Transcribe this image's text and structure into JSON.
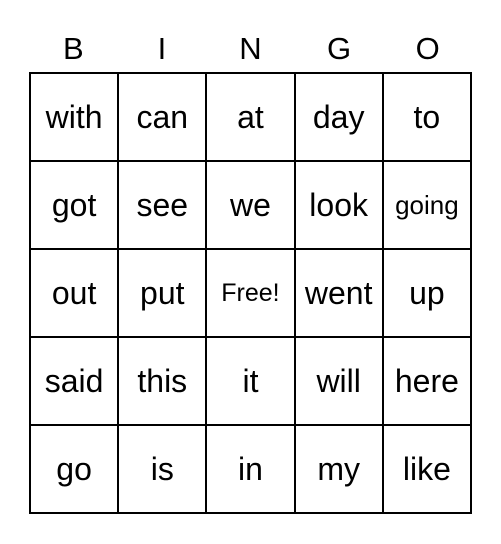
{
  "header": [
    "B",
    "I",
    "N",
    "G",
    "O"
  ],
  "rows": [
    [
      "with",
      "can",
      "at",
      "day",
      "to"
    ],
    [
      "got",
      "see",
      "we",
      "look",
      "going"
    ],
    [
      "out",
      "put",
      "Free!",
      "went",
      "up"
    ],
    [
      "said",
      "this",
      "it",
      "will",
      "here"
    ],
    [
      "go",
      "is",
      "in",
      "my",
      "like"
    ]
  ]
}
